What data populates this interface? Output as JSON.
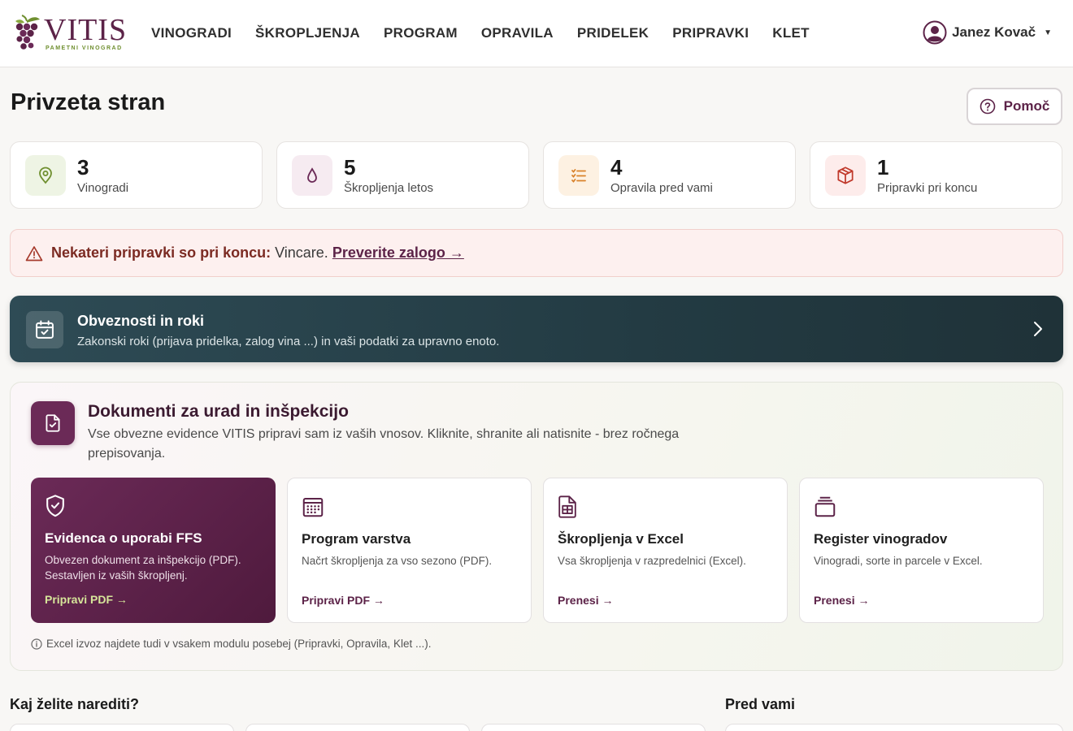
{
  "brand": {
    "name": "VITIS",
    "tagline": "PAMETNI VINOGRAD"
  },
  "nav": {
    "items": [
      "VINOGRADI",
      "ŠKROPLJENJA",
      "PROGRAM",
      "OPRAVILA",
      "PRIDELEK",
      "PRIPRAVKI",
      "KLET"
    ],
    "user": "Janez Kovač"
  },
  "page": {
    "title": "Privzeta stran",
    "help_label": "Pomoč"
  },
  "stats": [
    {
      "value": "3",
      "label": "Vinogradi"
    },
    {
      "value": "5",
      "label": "Škropljenja letos"
    },
    {
      "value": "4",
      "label": "Opravila pred vami"
    },
    {
      "value": "1",
      "label": "Pripravki pri koncu"
    }
  ],
  "alert": {
    "strong": "Nekateri pripravki so pri koncu:",
    "text": "Vincare.",
    "link": "Preverite zalogo →"
  },
  "obligations": {
    "title": "Obveznosti in roki",
    "subtitle": "Zakonski roki (prijava pridelka, zalog vina ...) in vaši podatki za upravno enoto."
  },
  "documents": {
    "title": "Dokumenti za urad in inšpekcijo",
    "description": "Vse obvezne evidence VITIS pripravi sam iz vaših vnosov. Kliknite, shranite ali natisnite - brez ročnega prepisovanja.",
    "cards": [
      {
        "title": "Evidenca o uporabi FFS",
        "desc": "Obvezen dokument za inšpekcijo (PDF). Sestavljen iz vaših škropljenj.",
        "link": "Pripravi PDF →"
      },
      {
        "title": "Program varstva",
        "desc": "Načrt škropljenja za vso sezono (PDF).",
        "link": "Pripravi PDF →"
      },
      {
        "title": "Škropljenja v Excel",
        "desc": "Vsa škropljenja v razpredelnici (Excel).",
        "link": "Prenesi →"
      },
      {
        "title": "Register vinogradov",
        "desc": "Vinogradi, sorte in parcele v Excel.",
        "link": "Prenesi →"
      }
    ],
    "note": "Excel izvoz najdete tudi v vsakem modulu posebej (Pripravki, Opravila, Klet ...)."
  },
  "bottom": {
    "actions_title": "Kaj želite narediti?",
    "ahead_title": "Pred vami"
  },
  "colors": {
    "brand": "#5c2348",
    "accent_green": "#6f8f2f",
    "banner": "#233b43",
    "alert_bg": "#fdf0ef"
  }
}
